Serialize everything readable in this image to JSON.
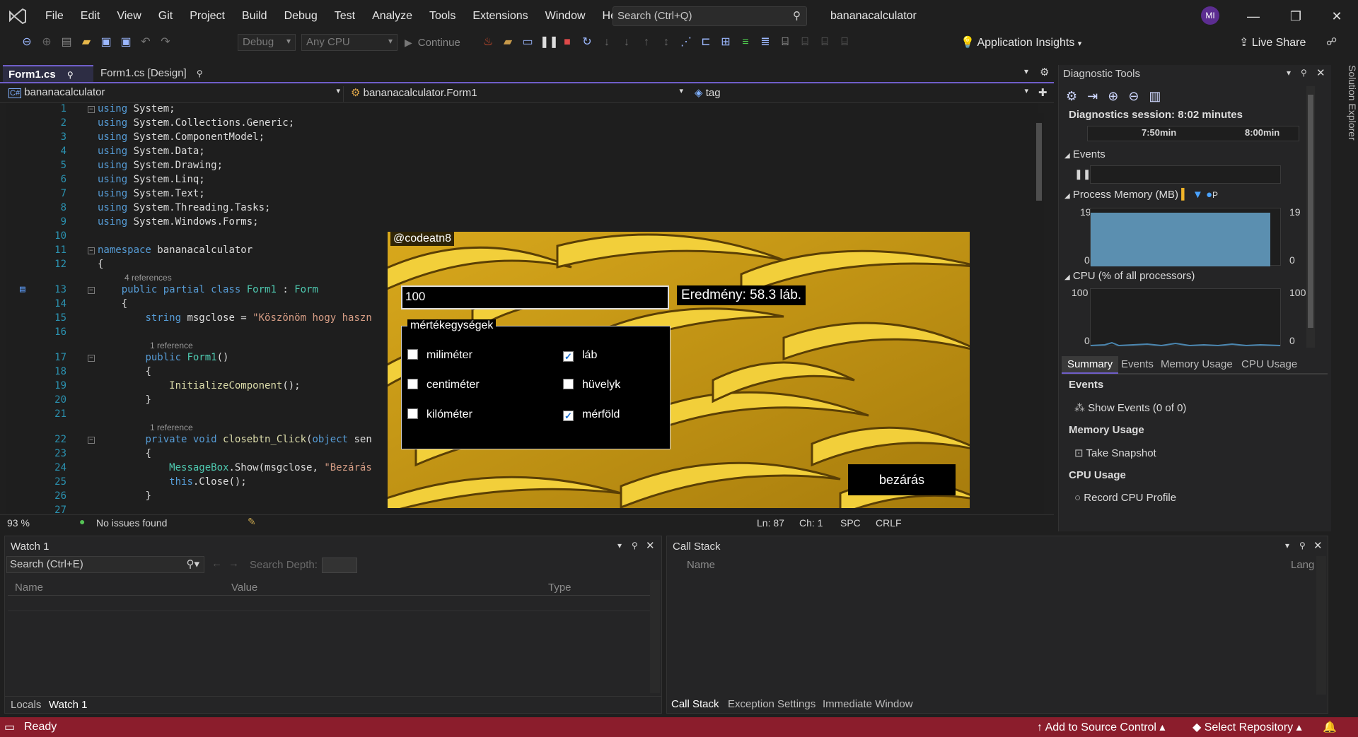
{
  "menu": [
    "File",
    "Edit",
    "View",
    "Git",
    "Project",
    "Build",
    "Debug",
    "Test",
    "Analyze",
    "Tools",
    "Extensions",
    "Window",
    "Help"
  ],
  "search": {
    "placeholder": "Search (Ctrl+Q)"
  },
  "app_title": "bananacalculator",
  "avatar": "MI",
  "toolbar": {
    "config": "Debug",
    "platform": "Any CPU",
    "continue": "Continue",
    "app_insights": "Application Insights",
    "live_share": "Live Share"
  },
  "tabs": [
    {
      "label": "Form1.cs"
    },
    {
      "label": "Form1.cs [Design]"
    }
  ],
  "nav": {
    "project": "bananacalculator",
    "class": "bananacalculator.Form1",
    "member": "tag"
  },
  "code": {
    "line_numbers": [
      "1",
      "2",
      "3",
      "4",
      "5",
      "6",
      "7",
      "8",
      "9",
      "10",
      "11",
      "12",
      "13",
      "14",
      "15",
      "16",
      "17",
      "18",
      "19",
      "20",
      "21",
      "22",
      "23",
      "24",
      "25",
      "26",
      "27"
    ],
    "refs": {
      "r4": "4 references",
      "r1a": "1 reference",
      "r1b": "1 reference"
    },
    "lines": {
      "l1": "System;",
      "l2": "System.Collections.Generic;",
      "l3": "System.ComponentModel;",
      "l4": "System.Data;",
      "l5": "System.Drawing;",
      "l6": "System.Linq;",
      "l7": "System.Text;",
      "l8": "System.Threading.Tasks;",
      "l9": "System.Windows.Forms;",
      "ns_kw": "namespace",
      "ns_name": "bananacalculator",
      "class_kw": "public partial class",
      "class_name": "Form1",
      "class_base": "Form",
      "msg_kw": "string",
      "msg_rest": "msgclose = ",
      "msg_str": "\"Köszönöm hogy haszn",
      "ctor_kw": "public",
      "ctor_name": "Form1",
      "init": "InitializeComponent",
      "click_kw": "private void",
      "click_name": "closebtn_Click",
      "click_obj": "object",
      "click_rest": " sen",
      "mb_class": "MessageBox",
      "mb_call": ".Show(msgclose, ",
      "mb_str": "\"Bezárás",
      "this_kw": "this",
      "close": ".Close();",
      "using": "using",
      "brace_open": "{",
      "brace_close": "}"
    }
  },
  "editor_status": {
    "zoom": "93 %",
    "issues": "No issues found",
    "ln": "Ln: 87",
    "ch": "Ch: 1",
    "spc": "SPC",
    "crlf": "CRLF"
  },
  "form": {
    "watermark": "@codeatn8",
    "input_value": "100",
    "result": "Eredmény: 58.3 láb.",
    "group_title": "mértékegységek",
    "checks": [
      {
        "label": "miliméter",
        "checked": false
      },
      {
        "label": "láb",
        "checked": true
      },
      {
        "label": "centiméter",
        "checked": false
      },
      {
        "label": "hüvelyk",
        "checked": false
      },
      {
        "label": "kilóméter",
        "checked": false
      },
      {
        "label": "mérföld",
        "checked": true
      }
    ],
    "close_label": "bezárás"
  },
  "diag": {
    "title": "Diagnostic Tools",
    "session": "Diagnostics session: 8:02 minutes",
    "t1": "7:50min",
    "t2": "8:00min",
    "events": "Events",
    "memory": "Process Memory (MB)",
    "mem_max": "19",
    "mem_min": "0",
    "cpu": "CPU (% of all processors)",
    "cpu_max": "100",
    "cpu_min": "0",
    "tabs": [
      "Summary",
      "Events",
      "Memory Usage",
      "CPU Usage"
    ],
    "sec_events": "Events",
    "show_events": "Show Events (0 of 0)",
    "sec_memory": "Memory Usage",
    "take_snapshot": "Take Snapshot",
    "sec_cpu": "CPU Usage",
    "record_cpu": "Record CPU Profile",
    "legend_p": "P"
  },
  "solution_explorer": "Solution Explorer",
  "watch": {
    "title": "Watch 1",
    "search": "Search (Ctrl+E)",
    "depth": "Search Depth:",
    "cols": [
      "Name",
      "Value",
      "Type"
    ],
    "tabs": [
      "Locals",
      "Watch 1"
    ]
  },
  "callstack": {
    "title": "Call Stack",
    "cols": [
      "Name",
      "Lang"
    ],
    "tabs": [
      "Call Stack",
      "Exception Settings",
      "Immediate Window"
    ]
  },
  "status": {
    "ready": "Ready",
    "source": "Add to Source Control",
    "repo": "Select Repository"
  }
}
